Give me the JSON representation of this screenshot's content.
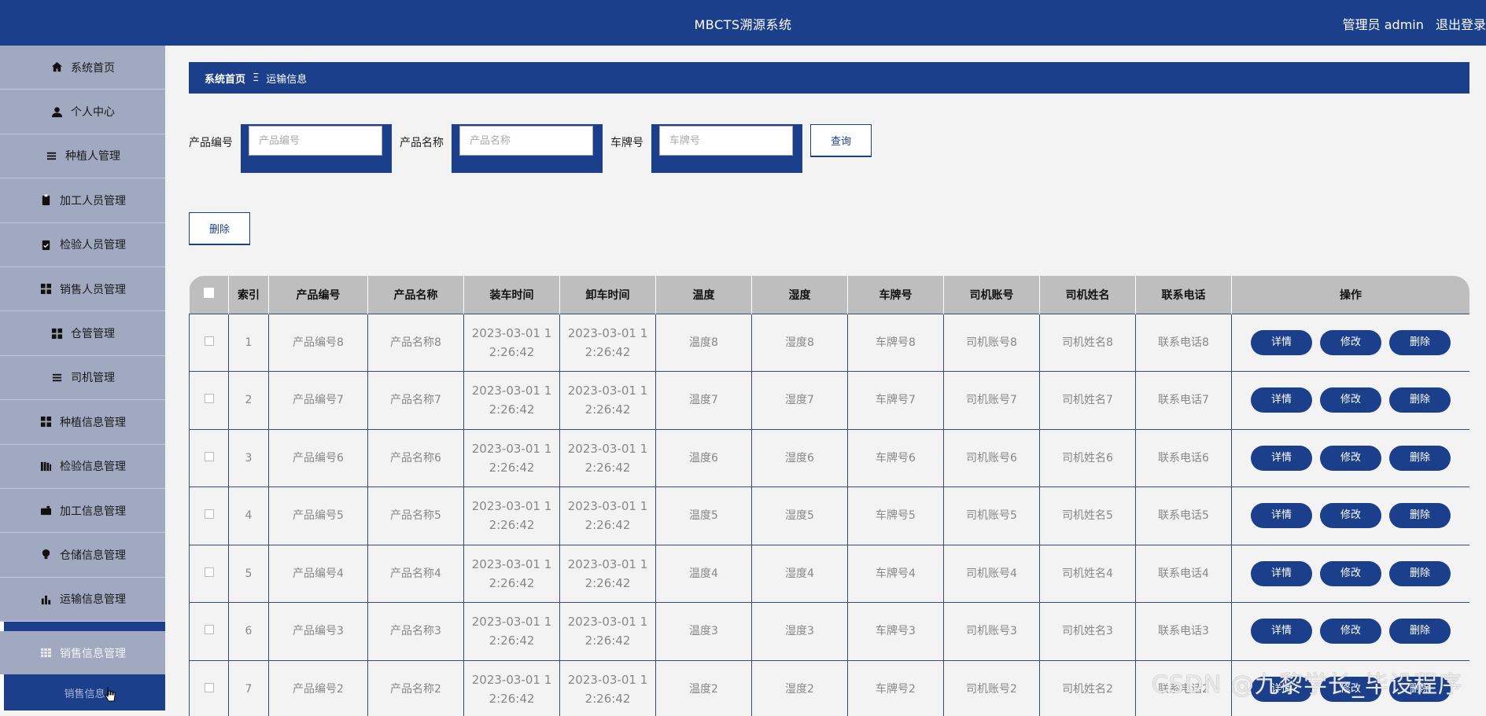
{
  "header": {
    "app_title": "MBCTS溯源系统",
    "user_label": "管理员 admin",
    "logout_label": "退出登录"
  },
  "sidebar": {
    "items": [
      {
        "label": "系统首页",
        "icon": "home-icon"
      },
      {
        "label": "个人中心",
        "icon": "person-icon"
      },
      {
        "label": "种植人管理",
        "icon": "list-icon"
      },
      {
        "label": "加工人员管理",
        "icon": "clipboard-icon"
      },
      {
        "label": "检验人员管理",
        "icon": "clipboard-check-icon"
      },
      {
        "label": "销售人员管理",
        "icon": "grid-icon"
      },
      {
        "label": "仓管管理",
        "icon": "grid-icon"
      },
      {
        "label": "司机管理",
        "icon": "list-icon"
      },
      {
        "label": "种植信息管理",
        "icon": "grid-icon"
      },
      {
        "label": "检验信息管理",
        "icon": "book-icon"
      },
      {
        "label": "加工信息管理",
        "icon": "briefcase-icon"
      },
      {
        "label": "仓储信息管理",
        "icon": "bulb-icon"
      },
      {
        "label": "运输信息管理",
        "icon": "bar-chart-icon"
      },
      {
        "label": "销售信息管理",
        "icon": "table-icon"
      }
    ],
    "submenu_item": "销售信息"
  },
  "breadcrumb": {
    "home": "系统首页",
    "separator": "Ξ",
    "current": "运输信息"
  },
  "search": {
    "product_code_label": "产品编号",
    "product_code_placeholder": "产品编号",
    "product_name_label": "产品名称",
    "product_name_placeholder": "产品名称",
    "plate_label": "车牌号",
    "plate_placeholder": "车牌号",
    "query_button": "查询"
  },
  "toolbar": {
    "delete_button": "删除"
  },
  "table": {
    "columns": [
      "索引",
      "产品编号",
      "产品名称",
      "装车时间",
      "卸车时间",
      "温度",
      "湿度",
      "车牌号",
      "司机账号",
      "司机姓名",
      "联系电话",
      "操作"
    ],
    "rows": [
      {
        "index": "1",
        "code": "产品编号8",
        "name": "产品名称8",
        "load_time_a": "2023-03-01 1",
        "load_time_b": "2:26:42",
        "unload_time_a": "2023-03-01 1",
        "unload_time_b": "2:26:42",
        "temp": "温度8",
        "humidity": "湿度8",
        "plate": "车牌号8",
        "driver_account": "司机账号8",
        "driver_name": "司机姓名8",
        "phone": "联系电话8"
      },
      {
        "index": "2",
        "code": "产品编号7",
        "name": "产品名称7",
        "load_time_a": "2023-03-01 1",
        "load_time_b": "2:26:42",
        "unload_time_a": "2023-03-01 1",
        "unload_time_b": "2:26:42",
        "temp": "温度7",
        "humidity": "湿度7",
        "plate": "车牌号7",
        "driver_account": "司机账号7",
        "driver_name": "司机姓名7",
        "phone": "联系电话7"
      },
      {
        "index": "3",
        "code": "产品编号6",
        "name": "产品名称6",
        "load_time_a": "2023-03-01 1",
        "load_time_b": "2:26:42",
        "unload_time_a": "2023-03-01 1",
        "unload_time_b": "2:26:42",
        "temp": "温度6",
        "humidity": "湿度6",
        "plate": "车牌号6",
        "driver_account": "司机账号6",
        "driver_name": "司机姓名6",
        "phone": "联系电话6"
      },
      {
        "index": "4",
        "code": "产品编号5",
        "name": "产品名称5",
        "load_time_a": "2023-03-01 1",
        "load_time_b": "2:26:42",
        "unload_time_a": "2023-03-01 1",
        "unload_time_b": "2:26:42",
        "temp": "温度5",
        "humidity": "湿度5",
        "plate": "车牌号5",
        "driver_account": "司机账号5",
        "driver_name": "司机姓名5",
        "phone": "联系电话5"
      },
      {
        "index": "5",
        "code": "产品编号4",
        "name": "产品名称4",
        "load_time_a": "2023-03-01 1",
        "load_time_b": "2:26:42",
        "unload_time_a": "2023-03-01 1",
        "unload_time_b": "2:26:42",
        "temp": "温度4",
        "humidity": "湿度4",
        "plate": "车牌号4",
        "driver_account": "司机账号4",
        "driver_name": "司机姓名4",
        "phone": "联系电话4"
      },
      {
        "index": "6",
        "code": "产品编号3",
        "name": "产品名称3",
        "load_time_a": "2023-03-01 1",
        "load_time_b": "2:26:42",
        "unload_time_a": "2023-03-01 1",
        "unload_time_b": "2:26:42",
        "temp": "温度3",
        "humidity": "湿度3",
        "plate": "车牌号3",
        "driver_account": "司机账号3",
        "driver_name": "司机姓名3",
        "phone": "联系电话3"
      },
      {
        "index": "7",
        "code": "产品编号2",
        "name": "产品名称2",
        "load_time_a": "2023-03-01 1",
        "load_time_b": "2:26:42",
        "unload_time_a": "2023-03-01 1",
        "unload_time_b": "2:26:42",
        "temp": "温度2",
        "humidity": "湿度2",
        "plate": "车牌号2",
        "driver_account": "司机账号2",
        "driver_name": "司机姓名2",
        "phone": "联系电话2"
      }
    ],
    "actions": {
      "detail": "详情",
      "edit": "修改",
      "delete": "删除"
    }
  },
  "watermark": "CSDN @九黎学长_毕设程序",
  "colors": {
    "primary": "#1c3f8c",
    "sidebar": "#a0a9c0",
    "header_row": "#bebebe",
    "background": "#f3f3f3"
  }
}
